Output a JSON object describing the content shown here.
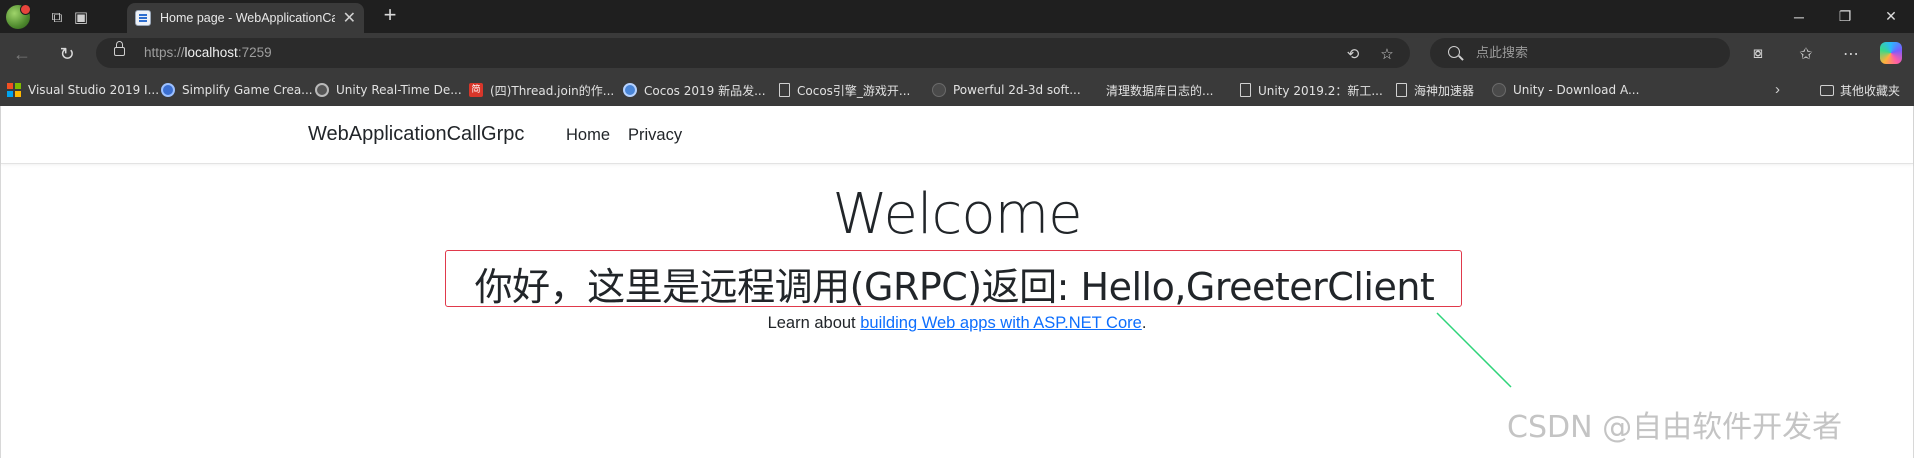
{
  "browser": {
    "tab": {
      "title": "Home page - WebApplicationCal",
      "favicon": "page-favicon"
    },
    "address": {
      "scheme": "https://",
      "host": "localhost",
      "port": ":7259"
    },
    "search": {
      "placeholder": "点此搜索"
    },
    "window_controls": {
      "minimize": "─",
      "restore": "❐",
      "close": "✕"
    },
    "icons": {
      "workspaces": "workspaces-icon",
      "tab_actions": "tab-actions-icon",
      "back": "back-icon",
      "refresh": "refresh-icon",
      "info": "site-info-icon",
      "reader": "read-aloud-icon",
      "favorite": "star-icon",
      "extensions": "extensions-icon",
      "favorites": "favorites-icon",
      "menu": "more-icon",
      "copilot": "copilot-icon"
    },
    "bookmarks": [
      {
        "label": "Visual Studio 2019 I...",
        "icon": "vs"
      },
      {
        "label": "Simplify Game Crea...",
        "icon": "round"
      },
      {
        "label": "Unity Real-Time De...",
        "icon": "unity"
      },
      {
        "label": "(四)Thread.join的作...",
        "icon": "jian",
        "glyph": "简"
      },
      {
        "label": "Cocos 2019 新品发...",
        "icon": "cocos"
      },
      {
        "label": "Cocos引擎_游戏开...",
        "icon": "page"
      },
      {
        "label": "Powerful 2d-3d soft...",
        "icon": "dim"
      },
      {
        "label": "清理数据库日志的...",
        "icon": "none"
      },
      {
        "label": "Unity 2019.2：新工...",
        "icon": "page"
      },
      {
        "label": "海神加速器",
        "icon": "page"
      },
      {
        "label": "Unity - Download A...",
        "icon": "dim"
      }
    ],
    "bookmarks_more": "›",
    "other_favorites": "其他收藏夹"
  },
  "site": {
    "brand": "WebApplicationCallGrpc",
    "nav": {
      "home": "Home",
      "privacy": "Privacy"
    },
    "heading": "Welcome",
    "grpc_message": "你好，这里是远程调用(GRPC)返回: Hello,GreeterClient",
    "learn_prefix": "Learn about ",
    "learn_link": "building Web apps with ASP.NET Core",
    "learn_suffix": "."
  },
  "annotation": {
    "box_color": "#e0394b",
    "arrow_color": "#2fd47a"
  },
  "watermark": "CSDN @自由软件开发者",
  "colors": {
    "chrome_bg": "#1f1f1f",
    "toolbar_bg": "#3a3a3a",
    "link": "#0d6efd"
  }
}
